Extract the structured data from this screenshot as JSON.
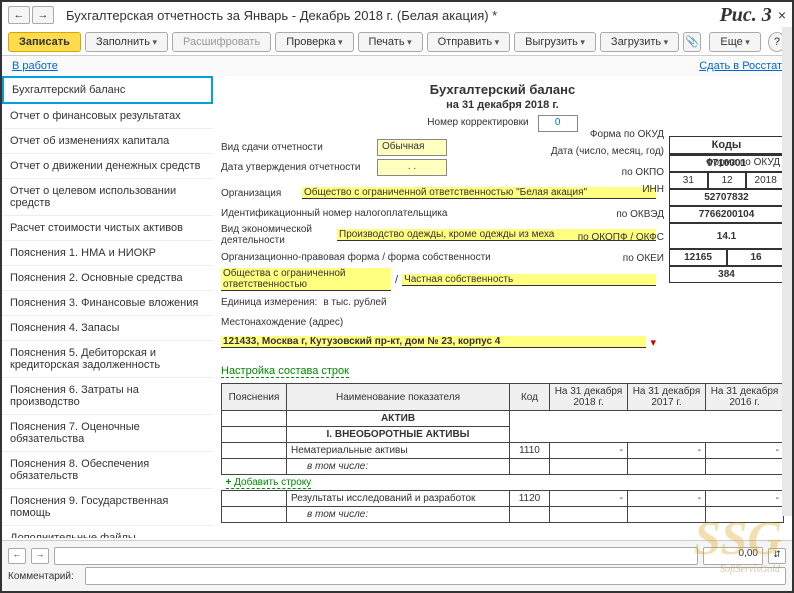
{
  "imageLabel": "Рис. 3",
  "title": "Бухгалтерская отчетность за Январь - Декабрь 2018 г. (Белая акация) *",
  "toolbar": {
    "save": "Записать",
    "fill": "Заполнить",
    "decode": "Расшифровать",
    "check": "Проверка",
    "print": "Печать",
    "send": "Отправить",
    "upload": "Выгрузить",
    "download": "Загрузить",
    "more": "Еще",
    "help": "?"
  },
  "status": {
    "inwork": "В работе",
    "submit": "Сдать в Росстат"
  },
  "sidebar": [
    "Бухгалтерский баланс",
    "Отчет о финансовых результатах",
    "Отчет об изменениях капитала",
    "Отчет о движении денежных средств",
    "Отчет о целевом использовании средств",
    "Расчет стоимости чистых активов",
    "Пояснения 1. НМА и НИОКР",
    "Пояснения 2. Основные средства",
    "Пояснения 3. Финансовые вложения",
    "Пояснения 4. Запасы",
    "Пояснения 5. Дебиторская и кредиторская задолженность",
    "Пояснения 6. Затраты на производство",
    "Пояснения 7. Оценочные обязательства",
    "Пояснения 8. Обеспечения обязательств",
    "Пояснения 9. Государственная помощь",
    "Дополнительные файлы"
  ],
  "doc": {
    "title": "Бухгалтерский баланс",
    "subtitle": "на 31 декабря 2018 г.",
    "corrNumLabel": "Номер корректировки",
    "corrNum": "0",
    "submitTypeLabel": "Вид сдачи отчетности",
    "submitType": "Обычная",
    "approveDateLabel": "Дата утверждения отчетности",
    "approveDate": ".  .",
    "orgLabel": "Организация",
    "org": "Общество с ограниченной ответственностью \"Белая акация\"",
    "innLabel": "Идентификационный номер налогоплательщика",
    "activityLabel": "Вид экономической деятельности",
    "activity": "Производство одежды, кроме одежды из меха",
    "formLabel": "Организационно-правовая форма / форма собственности",
    "form1": "Общества с ограниченной ответственностью",
    "form2": "Частная собственность",
    "unitLabel": "Единица измерения:",
    "unit": "в тыс. рублей",
    "addrLabel": "Местонахождение (адрес)",
    "addr": "121433, Москва г, Кутузовский пр-кт, дом № 23, корпус 4"
  },
  "codes": {
    "header": "Коды",
    "okudLabel": "Форма по ОКУД",
    "okud": "0710001",
    "dateLabel": "Дата (число, месяц, год)",
    "d": "31",
    "m": "12",
    "y": "2018",
    "okpoLabel": "по ОКПО",
    "okpo": "52707832",
    "innLabel": "ИНН",
    "inn": "7766200104",
    "okvedLabel": "по ОКВЭД",
    "okved": "14.1",
    "okopfLabel": "по ОКОПФ / ОКФС",
    "okopf": "12165",
    "okfs": "16",
    "okeiLabel": "по ОКЕИ",
    "okei": "384"
  },
  "configLink": "Настройка состава строк",
  "table": {
    "headers": [
      "Пояснения",
      "Наименование показателя",
      "Код",
      "На 31 декабря 2018 г.",
      "На 31 декабря 2017 г.",
      "На 31 декабря 2016 г."
    ],
    "section": "АКТИВ",
    "subsection": "I. ВНЕОБОРОТНЫЕ АКТИВЫ",
    "rows": [
      {
        "name": "Нематериальные активы",
        "code": "1110",
        "v18": "-",
        "v17": "-",
        "v16": "-"
      },
      {
        "name": "в том числе:",
        "code": "",
        "v18": "",
        "v17": "",
        "v16": ""
      }
    ],
    "addRow": "Добавить строку",
    "rows2": [
      {
        "name": "Результаты исследований и разработок",
        "code": "1120",
        "v18": "-",
        "v17": "-",
        "v16": "-"
      },
      {
        "name": "в том числе:",
        "code": "",
        "v18": "",
        "v17": "",
        "v16": ""
      }
    ]
  },
  "footer": {
    "numValue": "0,00",
    "updown": "⇵",
    "commentLabel": "Комментарий:"
  },
  "watermark": {
    "main": "SSG",
    "sub": "SoftServisGold"
  }
}
